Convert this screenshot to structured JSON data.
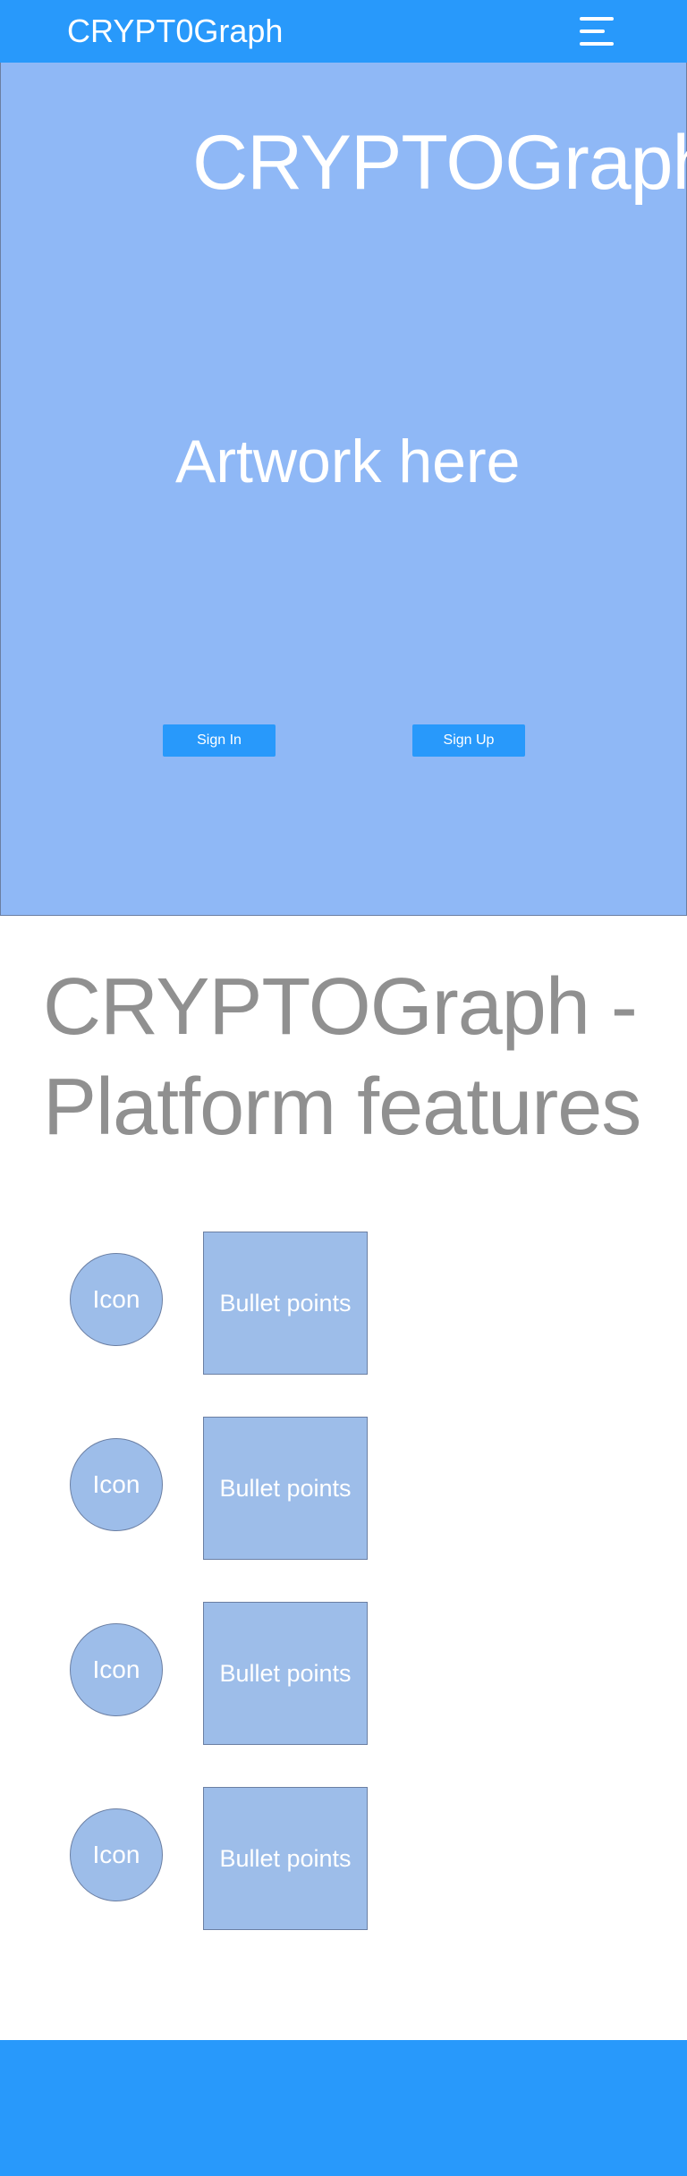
{
  "navbar": {
    "title": "CRYPT0Graph",
    "menu_icon": "hamburger-menu-icon"
  },
  "hero": {
    "title": "CRYPTOGraph",
    "artwork": "Artwork here",
    "sign_in_label": "Sign In",
    "sign_up_label": "Sign Up"
  },
  "features": {
    "heading": "CRYPTOGraph - Platform features",
    "items": [
      {
        "icon_label": "Icon",
        "text": "Bullet points"
      },
      {
        "icon_label": "Icon",
        "text": "Bullet points"
      },
      {
        "icon_label": "Icon",
        "text": "Bullet points"
      },
      {
        "icon_label": "Icon",
        "text": "Bullet points"
      }
    ]
  },
  "colors": {
    "primary_blue": "#2899fb",
    "hero_blue": "#8fb8f6",
    "placeholder_blue": "#9dbde9",
    "heading_gray": "#909090"
  }
}
